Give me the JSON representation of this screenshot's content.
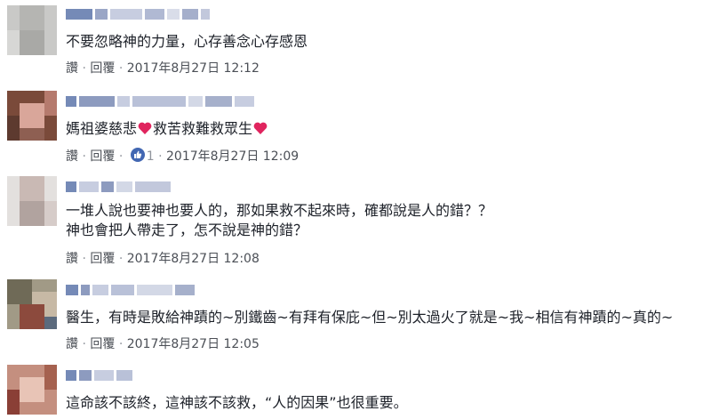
{
  "comments": [
    {
      "text_lines": [
        "不要忽略神的力量，心存善念心存感恩"
      ],
      "reply_label": "讚",
      "reply2_label": "回覆",
      "timestamp": "2017年8月27日 12:12",
      "likes": ""
    },
    {
      "text_parts": [
        "媽祖婆慈悲",
        "救苦救難救眾生"
      ],
      "reply_label": "讚",
      "reply2_label": "回覆",
      "timestamp": "2017年8月27日 12:09",
      "likes": "1"
    },
    {
      "text_lines": [
        "一堆人說也要神也要人的，那如果救不起來時，確都說是人的錯？？",
        "神也會把人帶走了，怎不說是神的錯？"
      ],
      "reply_label": "讚",
      "reply2_label": "回覆",
      "timestamp": "2017年8月27日 12:08",
      "likes": ""
    },
    {
      "text_lines": [
        "醫生，有時是敗給神蹟的~別鐵齒~有拜有保庇~但~別太過火了就是~我~相信有神蹟的~真的~"
      ],
      "reply_label": "讚",
      "reply2_label": "回覆",
      "timestamp": "2017年8月27日 12:05",
      "likes": ""
    },
    {
      "text_lines": [
        "這命該不該終，這神該不該救，“人的因果”也很重要。"
      ],
      "reply_label": "",
      "reply2_label": "",
      "timestamp": "",
      "likes": ""
    }
  ],
  "icons": {
    "heart": "heart-icon",
    "like": "thumbs-up-icon"
  },
  "colors": {
    "meta": "#90949c",
    "link": "#4b4f56",
    "heart": "#e0245e",
    "like_blue": "#4267b2"
  }
}
